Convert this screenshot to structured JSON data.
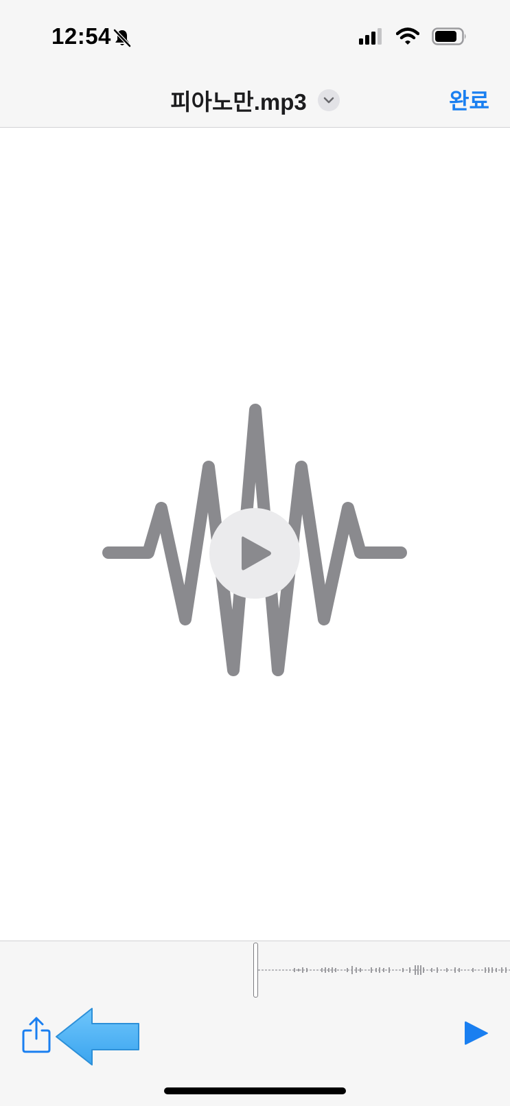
{
  "status": {
    "time": "12:54",
    "icons": [
      "bell-slash-icon",
      "cellular-signal-icon",
      "wifi-icon",
      "battery-icon"
    ]
  },
  "nav": {
    "title": "피아노만.mp3",
    "title_menu_icon": "chevron-down-icon",
    "done_label": "완료"
  },
  "preview": {
    "artwork_icon": "audio-waveform-icon",
    "play_icon": "play-icon"
  },
  "toolbar": {
    "share_icon": "share-icon",
    "annotation_icon": "left-arrow-emoji",
    "play_icon": "play-icon"
  },
  "colors": {
    "accent": "#1a7ff0",
    "waveform": "#8a8a8e",
    "bar_background": "#f6f6f6",
    "arrow": "#4cb3f5"
  }
}
